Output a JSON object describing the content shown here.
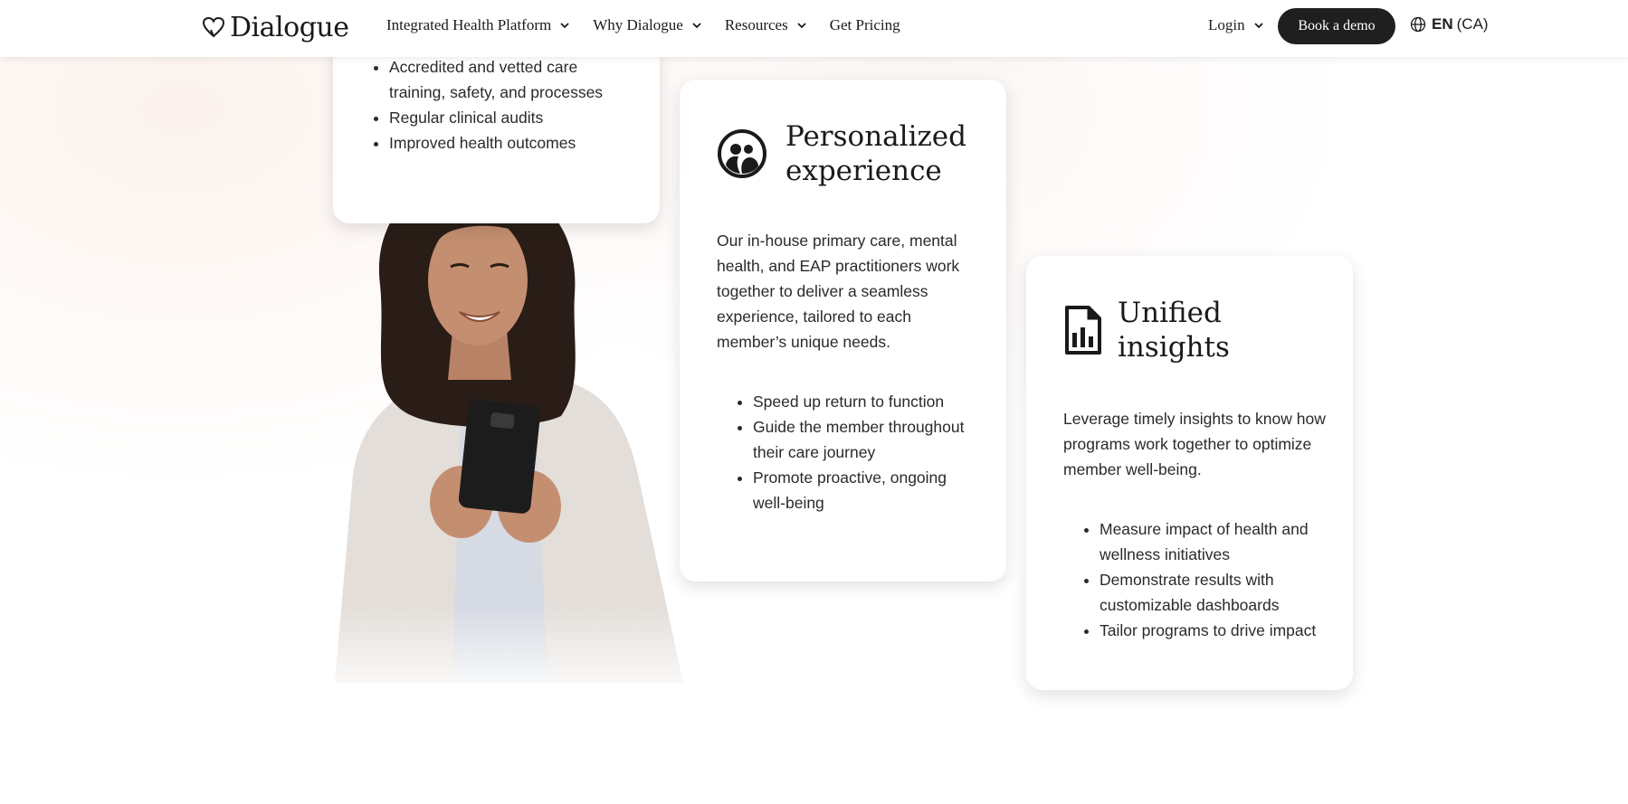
{
  "header": {
    "logo_text": "Dialogue",
    "nav": [
      {
        "label": "Integrated Health Platform",
        "has_dropdown": true
      },
      {
        "label": "Why Dialogue",
        "has_dropdown": true
      },
      {
        "label": "Resources",
        "has_dropdown": true
      },
      {
        "label": "Get Pricing",
        "has_dropdown": false
      }
    ],
    "login_label": "Login",
    "cta_label": "Book a demo",
    "lang_code": "EN",
    "lang_region": "(CA)"
  },
  "cards": {
    "quality": {
      "bullets": [
        "Accredited and vetted care training, safety, and processes",
        "Regular clinical audits",
        "Improved health outcomes"
      ]
    },
    "personalized": {
      "icon": "people-circle-icon",
      "title": "Personalized experience",
      "body": "Our in-house primary care, mental health, and EAP practitioners work together to deliver a seamless experience, tailored to each member’s unique needs.",
      "bullets": [
        "Speed up return to function",
        "Guide the member throughout their care journey",
        "Promote proactive, ongoing well-being"
      ]
    },
    "insights": {
      "icon": "report-chart-icon",
      "title": "Unified insights",
      "body": "Leverage timely insights to know how programs work together to optimize member well-being.",
      "bullets": [
        "Measure impact of health and wellness initiatives",
        "Demonstrate results with customizable dashboards",
        "Tailor programs to drive impact"
      ]
    }
  },
  "colors": {
    "brand_dark": "#1f1f1f",
    "background_tint": "#f9ece5"
  }
}
